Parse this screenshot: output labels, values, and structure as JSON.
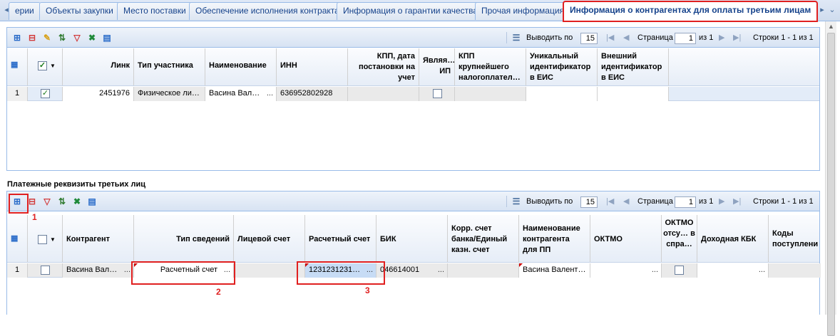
{
  "tabs": [
    {
      "label": "ерии"
    },
    {
      "label": "Объекты закупки"
    },
    {
      "label": "Место поставки"
    },
    {
      "label": "Обеспечение исполнения контракта"
    },
    {
      "label": "Информация о гарантии качества"
    },
    {
      "label": "Прочая информация"
    },
    {
      "label": "Информация о контрагентах для оплаты третьим лицам"
    }
  ],
  "pager": {
    "show_per_label": "Выводить по",
    "per_page": "15",
    "page_label": "Страница",
    "page": "1",
    "of_label": "из 1",
    "rows_label": "Строки 1 - 1 из 1"
  },
  "grid1": {
    "headers": [
      "Линк",
      "Тип участника",
      "Наименование",
      "ИНН",
      "КПП, дата постановки на учет",
      "Являя… ИП",
      "КПП крупнейшего налогоплател…",
      "Уникальный идентификатор в ЕИС",
      "Внешний идентификатор в ЕИС"
    ],
    "row": {
      "num": "1",
      "link": "2451976",
      "type": "Физическое ли…",
      "name": "Васина Вал…",
      "inn": "636952802928"
    }
  },
  "section2_title": "Платежные реквизиты третьих лиц",
  "grid2": {
    "headers": [
      "Контрагент",
      "Тип сведений",
      "Лицевой счет",
      "Расчетный счет",
      "БИК",
      "Корр. счет банка/Единый казн. счет",
      "Наименование контрагента для ПП",
      "ОКТМО",
      "ОКТМО отсу… в спра…",
      "Доходная КБК",
      "Коды поступлени"
    ],
    "row": {
      "num": "1",
      "contractor": "Васина Вал…",
      "info_type": "Расчетный счет",
      "account": "1231231231…",
      "bik": "046614001",
      "pp_name": "Васина Валент…"
    }
  },
  "annotations": [
    "1",
    "2",
    "3"
  ],
  "colors": {
    "highlight": "#e02020",
    "tab_text": "#15428b",
    "border": "#99bbe8"
  }
}
